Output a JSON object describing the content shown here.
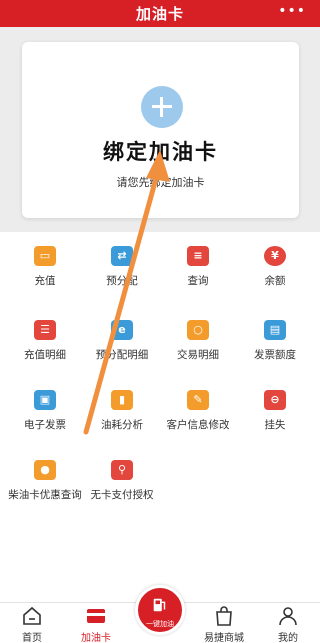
{
  "header": {
    "title": "加油卡",
    "more": "•••"
  },
  "bind_card": {
    "title": "绑定加油卡",
    "subtitle": "请您先绑定加油卡"
  },
  "menu": {
    "items": [
      {
        "label": "充值",
        "icon": "wallet-icon",
        "color": "#f39c2c"
      },
      {
        "label": "预分配",
        "icon": "transfer-icon",
        "color": "#3a9bd8"
      },
      {
        "label": "查询",
        "icon": "stack-icon",
        "color": "#e2463c"
      },
      {
        "label": "余额",
        "icon": "yen-coin-icon",
        "color": "#e2463c"
      },
      {
        "label": "充值明细",
        "icon": "recharge-detail-icon",
        "color": "#e2463c"
      },
      {
        "label": "预分配明细",
        "icon": "preallocation-detail-icon",
        "color": "#3a9bd8"
      },
      {
        "label": "交易明细",
        "icon": "search-document-icon",
        "color": "#f39c2c"
      },
      {
        "label": "发票额度",
        "icon": "invoice-quota-icon",
        "color": "#3a9bd8"
      },
      {
        "label": "电子发票",
        "icon": "e-invoice-icon",
        "color": "#3a9bd8"
      },
      {
        "label": "油耗分析",
        "icon": "bar-chart-icon",
        "color": "#f39c2c"
      },
      {
        "label": "客户信息修改",
        "icon": "edit-user-icon",
        "color": "#f39c2c"
      },
      {
        "label": "挂失",
        "icon": "report-loss-card-icon",
        "color": "#e2463c"
      },
      {
        "label": "柴油卡优惠查询",
        "icon": "ticket-icon",
        "color": "#f39c2c"
      },
      {
        "label": "无卡支付授权",
        "icon": "stamp-icon",
        "color": "#e2463c"
      }
    ]
  },
  "tabbar": {
    "tabs": [
      {
        "label": "首页",
        "icon": "home-icon"
      },
      {
        "label": "加油卡",
        "icon": "card-icon"
      },
      {
        "label": "一键加油",
        "icon": "fuel-pump-icon"
      },
      {
        "label": "易捷商城",
        "icon": "shopping-bag-icon"
      },
      {
        "label": "我的",
        "icon": "user-icon"
      }
    ]
  },
  "colors": {
    "brand": "#d71f26",
    "arrow": "#f0903e",
    "add_circle": "#9cc9ec"
  }
}
